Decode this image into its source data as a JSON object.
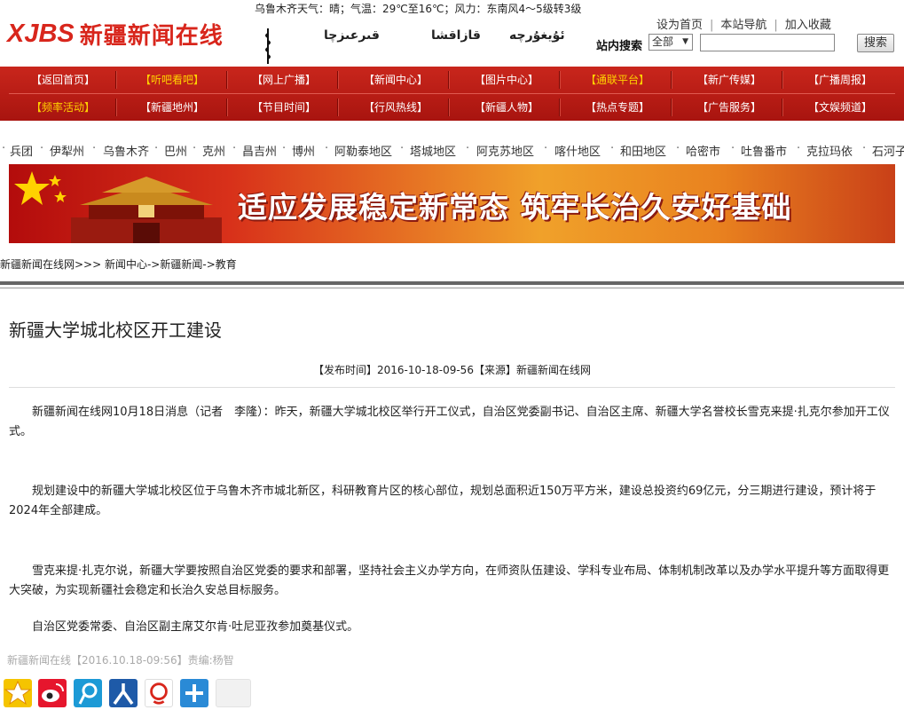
{
  "weather": "乌鲁木齐天气：晴；气温：29℃至16℃；风力：东南风4～5级转3级",
  "logo": {
    "en": "XJBS",
    "cn": "新疆新闻在线"
  },
  "languages": {
    "uyghur": "ئۇيغۇرچە",
    "kazakh": "قازاقشا",
    "kyrgyz": "قىرعىزچا"
  },
  "top_links": [
    "设为首页",
    "本站导航",
    "加入收藏"
  ],
  "search": {
    "label": "站内搜索",
    "scope": "全部",
    "button": "搜索",
    "value": ""
  },
  "nav_row1": [
    "【返回首页】",
    "【听吧看吧】",
    "【网上广播】",
    "【新闻中心】",
    "【图片中心】",
    "【通联平台】",
    "【新广传媒】",
    "【广播周报】"
  ],
  "nav_row2": [
    "【频率活动】",
    "【新疆地州】",
    "【节目时间】",
    "【行风热线】",
    "【新疆人物】",
    "【热点专题】",
    "【广告服务】",
    "【文娱频道】"
  ],
  "regions": [
    "兵团",
    "伊犁州",
    "乌鲁木齐",
    "巴州",
    "克州",
    "昌吉州",
    "博州",
    "阿勒泰地区",
    "塔城地区",
    "阿克苏地区",
    "喀什地区",
    "和田地区",
    "哈密市",
    "吐鲁番市",
    "克拉玛依",
    "石河子"
  ],
  "banner": {
    "slogan": "适应发展稳定新常态  筑牢长治久安好基础"
  },
  "breadcrumb": "新疆新闻在线网>>>  新闻中心->新疆新闻->教育",
  "article": {
    "title": "新疆大学城北校区开工建设",
    "meta": "【发布时间】2016-10-18-09-56【来源】新疆新闻在线网",
    "paragraphs": [
      "新疆新闻在线网10月18日消息（记者　李隆）：昨天，新疆大学城北校区举行开工仪式，自治区党委副书记、自治区主席、新疆大学名誉校长雪克来提·扎克尔参加开工仪式。",
      "规划建设中的新疆大学城北校区位于乌鲁木齐市城北新区，科研教育片区的核心部位，规划总面积近150万平方米，建设总投资约69亿元，分三期进行建设，预计将于2024年全部建成。",
      "雪克来提·扎克尔说，新疆大学要按照自治区党委的要求和部署，坚持社会主义办学方向，在师资队伍建设、学科专业布局、体制机制改革以及办学水平提升等方面取得更大突破，为实现新疆社会稳定和长治久安总目标服务。",
      "自治区党委常委、自治区副主席艾尔肯·吐尼亚孜参加奠基仪式。"
    ],
    "footer": "新疆新闻在线【2016.10.18-09:56】责编:杨智"
  },
  "share_icons": [
    "qzone-icon",
    "weibo-icon",
    "tencent-weibo-icon",
    "renren-icon",
    "kaixin-icon",
    "more-share-icon"
  ],
  "colors": {
    "brand_red": "#d8261c",
    "nav_red": "#b81a12",
    "nav_highlight": "#ffd200"
  }
}
